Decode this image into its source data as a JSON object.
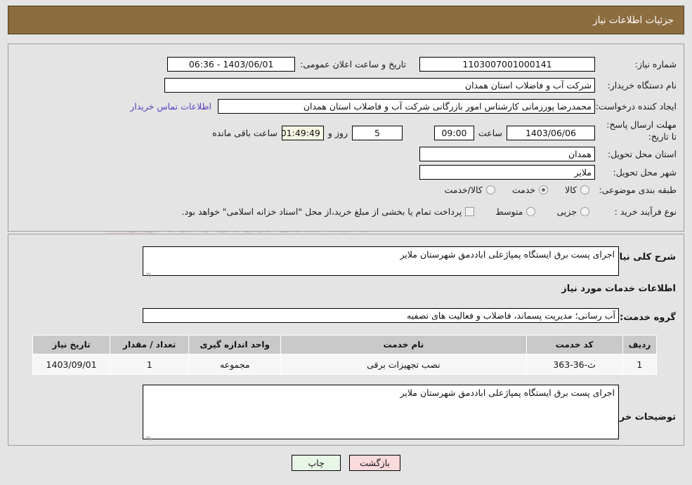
{
  "header": {
    "title": "جزئیات اطلاعات نیاز"
  },
  "watermark": {
    "text": "AriaTender",
    "suffix": ".net"
  },
  "top_panel": {
    "need_number": {
      "label": "شماره نیاز:",
      "value": "1103007001000141"
    },
    "announcement_datetime": {
      "label": "تاریخ و ساعت اعلان عمومی:",
      "value": "1403/06/01 - 06:36"
    },
    "buyer_org": {
      "label": "نام دستگاه خریدار:",
      "value": "شرکت آب و فاضلاب استان همدان"
    },
    "requester": {
      "label": "ایجاد کننده درخواست:",
      "value": "محمدرضا پورزمانی کارشناس امور بازرگانی شرکت آب و فاضلاب استان همدان",
      "contact_link": "اطلاعات تماس خریدار"
    },
    "deadline": {
      "label": "مهلت ارسال پاسخ: تا تاریخ:",
      "date": "1403/06/06",
      "time_label": "ساعت",
      "time": "09:00",
      "days_remaining": "5",
      "days_label": "روز و",
      "timer": "01:49:49",
      "timer_suffix": "ساعت باقی مانده"
    },
    "province": {
      "label": "استان محل تحویل:",
      "value": "همدان"
    },
    "city": {
      "label": "شهر محل تحویل:",
      "value": "ملایر"
    },
    "category": {
      "label": "طبقه بندی موضوعی:",
      "options": [
        {
          "label": "کالا",
          "checked": false
        },
        {
          "label": "خدمت",
          "checked": true
        },
        {
          "label": "کالا/خدمت",
          "checked": false
        }
      ]
    },
    "purchase_type": {
      "label": "نوع فرآیند خرید :",
      "options": [
        {
          "label": "جزیی",
          "checked": false
        },
        {
          "label": "متوسط",
          "checked": false
        }
      ],
      "treasury_checkbox_label": "پرداخت تمام یا بخشی از مبلغ خرید،از محل \"اسناد خزانه اسلامی\" خواهد بود.",
      "treasury_checked": false
    }
  },
  "bottom_panel": {
    "need_summary": {
      "label": "شرح کلی نیاز:",
      "value": "اجرای پست برق ایستگاه پمپاژعلی اباددمق شهرستان ملایر"
    },
    "services_section_title": "اطلاعات خدمات مورد نیاز",
    "service_group": {
      "label": "گروه خدمت:",
      "value": "آب رسانی؛ مدیریت پسماند، فاضلاب و فعالیت های تصفیه"
    },
    "table": {
      "columns": [
        "ردیف",
        "کد خدمت",
        "نام خدمت",
        "واحد اندازه گیری",
        "تعداد / مقدار",
        "تاریخ نیاز"
      ],
      "rows": [
        {
          "row_no": "1",
          "service_code": "ث-36-363",
          "service_name": "نصب تجهیزات برقی",
          "unit": "مجموعه",
          "quantity": "1",
          "need_date": "1403/09/01"
        }
      ]
    },
    "buyer_notes": {
      "label": "توضیحات خریدار:",
      "value": "اجرای پست برق ایستگاه پمپاژعلی اباددمق شهرستان ملایر"
    }
  },
  "footer": {
    "back_button": "بازگشت",
    "print_button": "چاپ"
  },
  "colors": {
    "header_brown": "#8c6d3f",
    "page_background": "#e4e4e4",
    "timer_background": "#f7f7e4",
    "link_purple": "#5b3fbf",
    "back_button_bg": "#fadadd",
    "print_button_bg": "#e8f6e8",
    "table_header_bg": "#c9c9c9"
  }
}
